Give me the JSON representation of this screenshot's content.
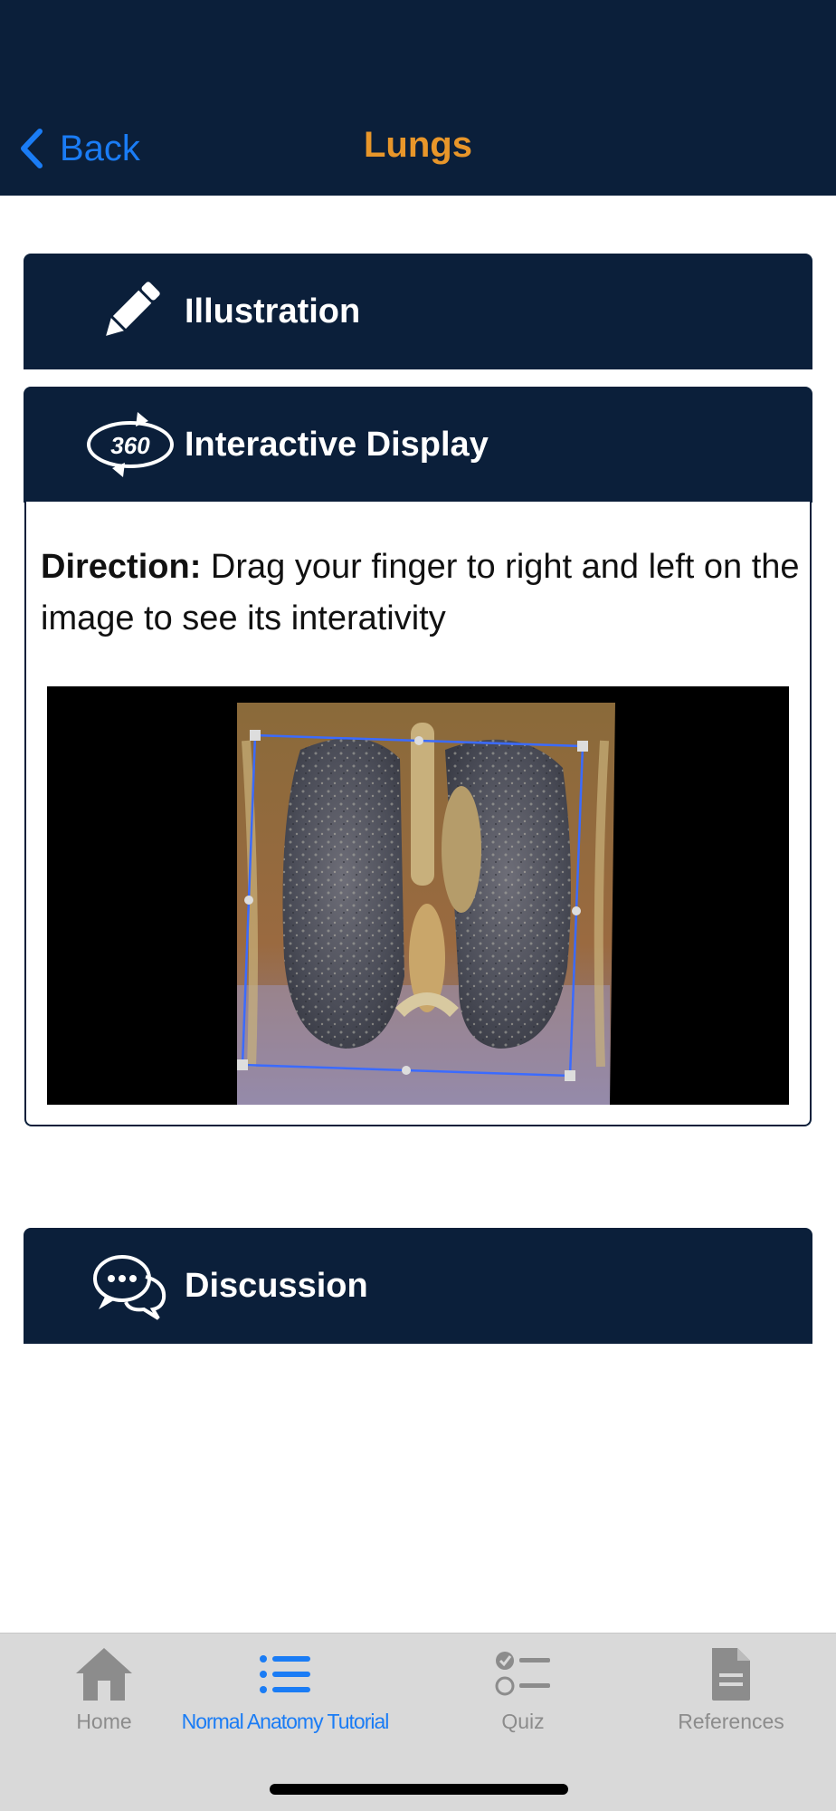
{
  "navbar": {
    "back_label": "Back",
    "title": "Lungs"
  },
  "sections": {
    "illustration": {
      "label": "Illustration",
      "icon": "pencil-icon"
    },
    "interactive": {
      "label": "Interactive Display",
      "icon": "rotate-360-icon",
      "icon_text": "360",
      "direction_label": "Direction:",
      "direction_text": " Drag your finger to right and left on the image to see its interativity",
      "image": "lungs-ct-coronal-3d-render"
    },
    "discussion": {
      "label": "Discussion",
      "icon": "chat-bubbles-icon"
    }
  },
  "tabbar": {
    "items": [
      {
        "label": "Home",
        "icon": "house-icon",
        "active": false
      },
      {
        "label": "Normal Anatomy Tutorial",
        "icon": "list-icon",
        "active": true
      },
      {
        "label": "Quiz",
        "icon": "checklist-icon",
        "active": false
      },
      {
        "label": "References",
        "icon": "document-icon",
        "active": false
      }
    ]
  },
  "colors": {
    "navy": "#0b1f3a",
    "accent_orange": "#e8962a",
    "ios_blue": "#1a7cf5",
    "tab_inactive": "#8c8c8c"
  }
}
